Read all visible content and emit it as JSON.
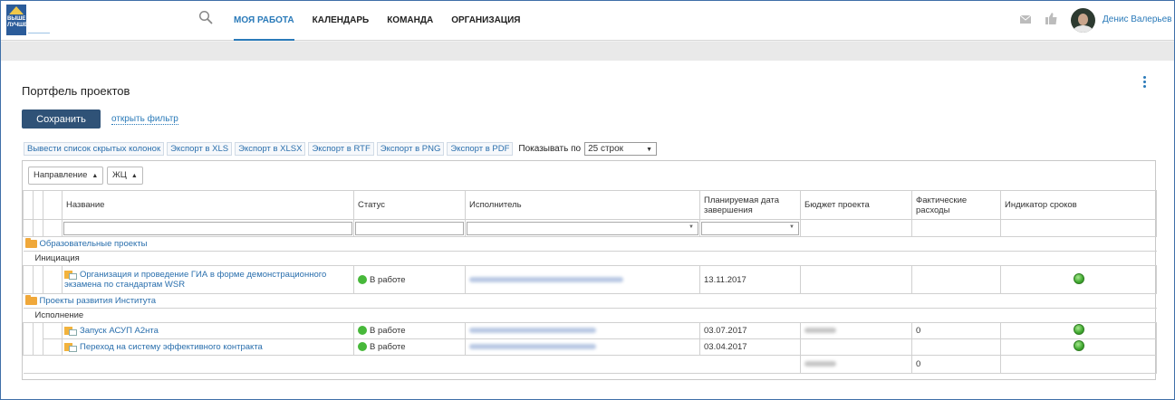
{
  "header": {
    "logo_text": "ВЫШЕ ЛУЧШЕ",
    "nav": [
      "МОЯ РАБОТА",
      "КАЛЕНДАРЬ",
      "КОМАНДА",
      "ОРГАНИЗАЦИЯ"
    ],
    "active_nav": "МОЯ РАБОТА",
    "user_name": "Денис Валерьев",
    "icons": [
      "search-icon",
      "mail-icon",
      "like-icon"
    ],
    "accent_color": "#2a7ab9"
  },
  "page": {
    "title": "Портфель проектов",
    "save_label": "Сохранить",
    "filter_link": "открыть фильтр"
  },
  "toolbar": {
    "buttons": [
      "Вывести список скрытых колонок",
      "Экспорт в XLS",
      "Экспорт в XLSX",
      "Экспорт в RTF",
      "Экспорт в PNG",
      "Экспорт в PDF"
    ],
    "show_label": "Показывать по",
    "rows_selected": "25 строк"
  },
  "grid": {
    "group_chips": [
      "Направление",
      "ЖЦ"
    ],
    "columns": [
      "Название",
      "Статус",
      "Исполнитель",
      "Планируемая дата завершения",
      "Бюджет проекта",
      "Фактические расходы",
      "Индикатор сроков"
    ],
    "groups": [
      {
        "name": "Образовательные проекты",
        "stage": "Инициация",
        "rows": [
          {
            "name": "Организация и проведение ГИА в форме демонстрационного экзамена по стандартам WSR",
            "status": "В работе",
            "date": "13.11.2017",
            "budget": "",
            "actual": "",
            "indicator": "green"
          }
        ]
      },
      {
        "name": "Проекты развития Института",
        "stage": "Исполнение",
        "rows": [
          {
            "name": "Запуск АСУП А2нта",
            "status": "В работе",
            "date": "03.07.2017",
            "budget": "",
            "actual": "0",
            "indicator": "green"
          },
          {
            "name": "Переход на систему эффективного контракта",
            "status": "В работе",
            "date": "03.04.2017",
            "budget": "",
            "actual": "",
            "indicator": "green"
          }
        ]
      }
    ],
    "total_actual": "0"
  }
}
